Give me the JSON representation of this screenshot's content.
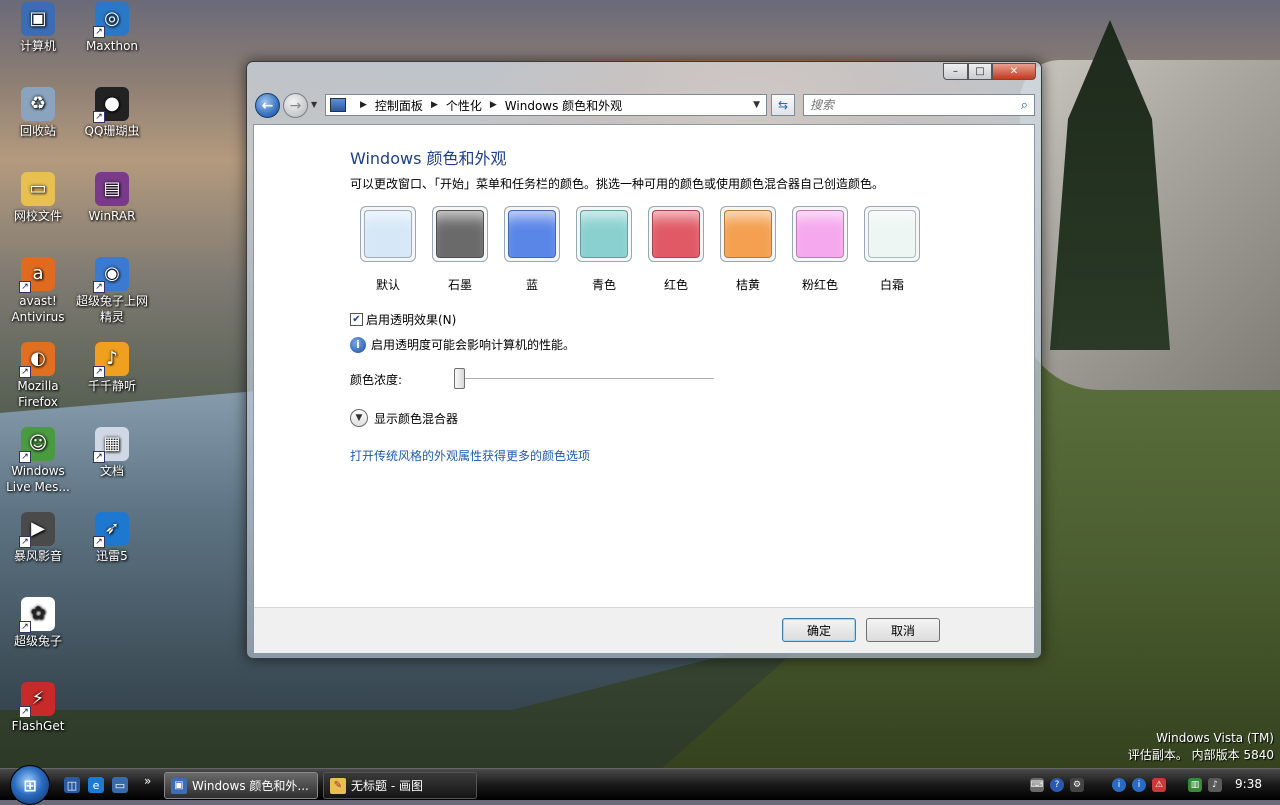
{
  "desktop_icons": [
    {
      "label": "计算机",
      "icon": "computer-icon",
      "color": "#3c6cb4"
    },
    {
      "label": "Maxthon",
      "icon": "maxthon-icon",
      "color": "#2a78c8"
    },
    {
      "label": "回收站",
      "icon": "recycle-bin-icon",
      "color": "#8aa4c0"
    },
    {
      "label": "QQ珊瑚虫",
      "icon": "qq-penguin-icon",
      "color": "#222222"
    },
    {
      "label": "网校文件",
      "icon": "folder-icon",
      "color": "#e8c050"
    },
    {
      "label": "WinRAR",
      "icon": "winrar-icon",
      "color": "#7a3a8a"
    },
    {
      "label": "avast! Antivirus",
      "icon": "avast-icon",
      "color": "#e06a20"
    },
    {
      "label": "超级兔子上网精灵",
      "icon": "rabbit-browser-icon",
      "color": "#3a7ad0"
    },
    {
      "label": "Mozilla Firefox",
      "icon": "firefox-icon",
      "color": "#e07020"
    },
    {
      "label": "千千静听",
      "icon": "ttplayer-icon",
      "color": "#f0a020"
    },
    {
      "label": "Windows Live Mes...",
      "icon": "messenger-icon",
      "color": "#4a9a40"
    },
    {
      "label": "文档",
      "icon": "document-icon",
      "color": "#cfd8e4"
    },
    {
      "label": "暴风影音",
      "icon": "storm-player-icon",
      "color": "#4a4a4a"
    },
    {
      "label": "迅雷5",
      "icon": "thunder-icon",
      "color": "#1e78d0"
    },
    {
      "label": "超级兔子",
      "icon": "rabbit-icon",
      "color": "#ffffff"
    },
    {
      "label": "FlashGet",
      "icon": "flashget-icon",
      "color": "#c82a2a"
    }
  ],
  "window": {
    "min_label": "–",
    "max_label": "□",
    "close_label": "✕",
    "breadcrumb": [
      "控制面板",
      "个性化",
      "Windows 颜色和外观"
    ],
    "search_placeholder": "搜索",
    "title": "Windows 颜色和外观",
    "description": "可以更改窗口、「开始」菜单和任务栏的颜色。挑选一种可用的颜色或使用颜色混合器自己创造颜色。",
    "swatches": [
      {
        "label": "默认",
        "color": "#d6e8f8"
      },
      {
        "label": "石墨",
        "color": "#6a6a6a"
      },
      {
        "label": "蓝",
        "color": "#5a86e8"
      },
      {
        "label": "青色",
        "color": "#8ad0d0"
      },
      {
        "label": "红色",
        "color": "#e05a66"
      },
      {
        "label": "桔黄",
        "color": "#f4a050"
      },
      {
        "label": "粉红色",
        "color": "#f6a8ee"
      },
      {
        "label": "白霜",
        "color": "#eef6f4"
      }
    ],
    "transparency_label": "启用透明效果(N)",
    "transparency_checked": true,
    "info_text": "启用透明度可能会影响计算机的性能。",
    "intensity_label": "颜色浓度:",
    "intensity_value": 0,
    "mixer_label": "显示颜色混合器",
    "classic_link": "打开传统风格的外观属性获得更多的颜色选项",
    "ok_label": "确定",
    "cancel_label": "取消"
  },
  "watermark": {
    "line1": "Windows Vista (TM)",
    "line2": "评估副本。 内部版本 5840"
  },
  "taskbar": {
    "tasks": [
      {
        "label": "Windows 颜色和外...",
        "icon": "control-panel-icon",
        "active": true
      },
      {
        "label": "无标题 - 画图",
        "icon": "paint-icon",
        "active": false
      }
    ],
    "more_label": "»",
    "clock": "9:38"
  }
}
